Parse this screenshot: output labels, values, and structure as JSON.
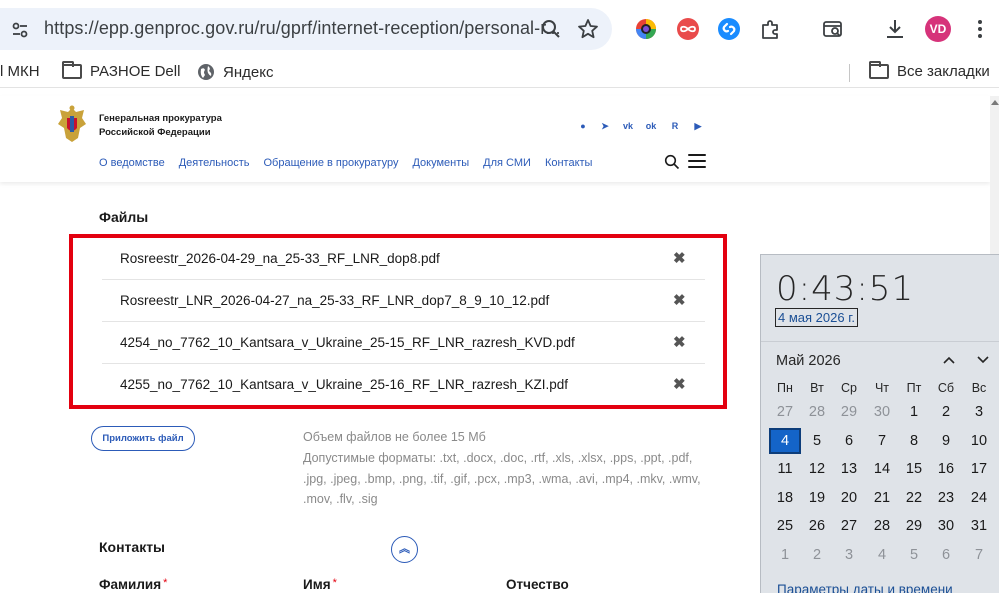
{
  "browser": {
    "url": "https://epp.genproc.gov.ru/ru/gprf/internet-reception/personal-r...",
    "avatar": "VD"
  },
  "bookmarks": {
    "items": [
      "l МКН",
      "РАЗНОЕ Dell",
      "Яндекс"
    ],
    "all": "Все закладки"
  },
  "site": {
    "org_line1": "Генеральная прокуратура",
    "org_line2": "Российской Федерации",
    "social": [
      "●",
      "➤",
      "vk",
      "ok",
      "R",
      "▶"
    ],
    "nav": [
      "О ведомстве",
      "Деятельность",
      "Обращение в прокуратуру",
      "Документы",
      "Для СМИ",
      "Контакты"
    ]
  },
  "files": {
    "title": "Файлы",
    "items": [
      "Rosreestr_2026-04-29_na_25-33_RF_LNR_dop8.pdf",
      "Rosreestr_LNR_2026-04-27_na_25-33_RF_LNR_dop7_8_9_10_12.pdf",
      "4254_no_7762_10_Kantsara_v_Ukraine_25-15_RF_LNR_razresh_KVD.pdf",
      "4255_no_7762_10_Kantsara_v_Ukraine_25-16_RF_LNR_razresh_KZI.pdf"
    ],
    "remove_glyph": "✖",
    "attach_label": "Приложить файл",
    "hint_size": "Объем файлов не более 15 Мб",
    "hint_formats": "Допустимые форматы: .txt, .docx, .doc, .rtf, .xls, .xlsx, .pps, .ppt, .pdf, .jpg, .jpeg, .bmp, .png, .tif, .gif, .pcx, .mp3, .wma, .avi, .mp4, .mkv, .wmv, .mov, .flv, .sig"
  },
  "contacts": {
    "title": "Контакты",
    "up_glyph": "︽",
    "fields": [
      "Фамилия",
      "Имя",
      "Отчество"
    ],
    "required_mark": "*"
  },
  "calendar": {
    "time": "0:43:51",
    "date": "4 мая 2026 г.",
    "month": "Май 2026",
    "weekdays": [
      "Пн",
      "Вт",
      "Ср",
      "Чт",
      "Пт",
      "Сб",
      "Вс"
    ],
    "weeks": [
      [
        "27",
        "28",
        "29",
        "30",
        "1",
        "2",
        "3"
      ],
      [
        "4",
        "5",
        "6",
        "7",
        "8",
        "9",
        "10"
      ],
      [
        "11",
        "12",
        "13",
        "14",
        "15",
        "16",
        "17"
      ],
      [
        "18",
        "19",
        "20",
        "21",
        "22",
        "23",
        "24"
      ],
      [
        "25",
        "26",
        "27",
        "28",
        "29",
        "30",
        "31"
      ],
      [
        "1",
        "2",
        "3",
        "4",
        "5",
        "6",
        "7"
      ]
    ],
    "today": "4",
    "settings_link": "Параметры даты и времени"
  },
  "colors": {
    "highlight_border": "#e3000f",
    "link_blue": "#2c5bb8",
    "today_bg": "#1464c8"
  }
}
